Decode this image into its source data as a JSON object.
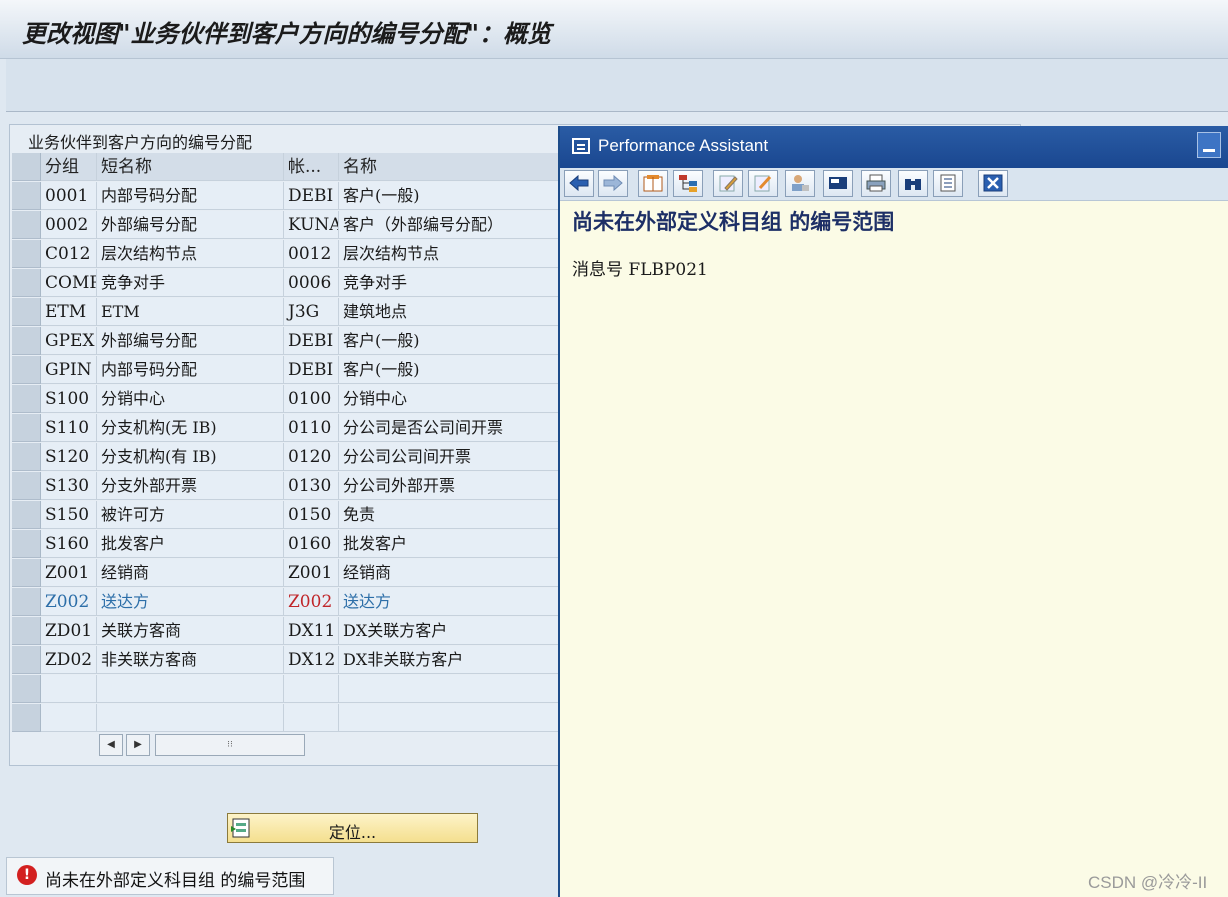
{
  "window": {
    "title": "更改视图\"业务伙伴到客户方向的编号分配\"：概览"
  },
  "panel": {
    "title": "业务伙伴到客户方向的编号分配",
    "columns": [
      "分组",
      "短名称",
      "帐...",
      "名称"
    ],
    "rows": [
      [
        "0001",
        "内部号码分配",
        "DEBI",
        "客户(一般)"
      ],
      [
        "0002",
        "外部编号分配",
        "KUNA",
        "客户（外部编号分配）"
      ],
      [
        "C012",
        "层次结构节点",
        "0012",
        "层次结构节点"
      ],
      [
        "COMP",
        "竞争对手",
        "0006",
        "竞争对手"
      ],
      [
        "ETM",
        "ETM",
        "J3G",
        "建筑地点"
      ],
      [
        "GPEX",
        "外部编号分配",
        "DEBI",
        "客户(一般)"
      ],
      [
        "GPIN",
        "内部号码分配",
        "DEBI",
        "客户(一般)"
      ],
      [
        "S100",
        "分销中心",
        "0100",
        "分销中心"
      ],
      [
        "S110",
        "分支机构(无 IB)",
        "0110",
        "分公司是否公司间开票"
      ],
      [
        "S120",
        "分支机构(有 IB)",
        "0120",
        "分公司公司间开票"
      ],
      [
        "S130",
        "分支外部开票",
        "0130",
        "分公司外部开票"
      ],
      [
        "S150",
        "被许可方",
        "0150",
        "免责"
      ],
      [
        "S160",
        "批发客户",
        "0160",
        "批发客户"
      ],
      [
        "Z001",
        "经销商",
        "Z001",
        "经销商"
      ],
      [
        "Z002",
        "送达方",
        "Z002",
        "送达方"
      ],
      [
        "ZD01",
        "关联方客商",
        "DX11",
        "DX关联方客户"
      ],
      [
        "ZD02",
        "非关联方客商",
        "DX12",
        "DX非关联方客户"
      ]
    ],
    "highlighted_row": 14,
    "position_button": "定位..."
  },
  "status": {
    "message": "尚未在外部定义科目组 的编号范围"
  },
  "assistant": {
    "title": "Performance Assistant",
    "heading": "尚未在外部定义科目组 的编号范围",
    "message_no": "消息号 FLBP021"
  },
  "watermark": "CSDN @冷冷-II",
  "colors": {
    "title_bar": "#1a4790",
    "assistant_bg": "#fbfbe6",
    "highlight_text": "#2c6ea8",
    "highlight_acc": "#c0262a"
  }
}
